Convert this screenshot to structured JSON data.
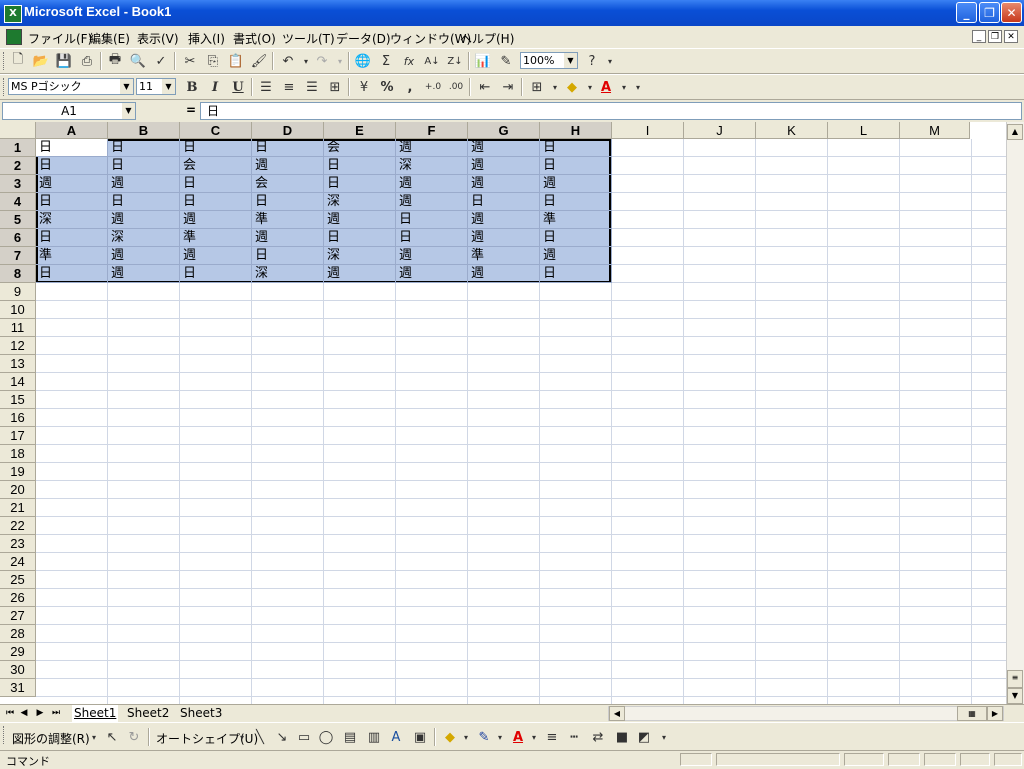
{
  "window": {
    "title": "Microsoft Excel - Book1",
    "app_icon": "X"
  },
  "menu": [
    "ファイル(F)",
    "編集(E)",
    "表示(V)",
    "挿入(I)",
    "書式(O)",
    "ツール(T)",
    "データ(D)",
    "ウィンドウ(W)",
    "ヘルプ(H)"
  ],
  "standard_toolbar": {
    "zoom": "100%"
  },
  "format_toolbar": {
    "font": "MS Pゴシック",
    "size": "11",
    "bold": "B",
    "italic": "I",
    "underline": "U",
    "percent": "%",
    "comma": ","
  },
  "formula_bar": {
    "name_box": "A1",
    "equals": "=",
    "content": "日"
  },
  "columns": [
    "A",
    "B",
    "C",
    "D",
    "E",
    "F",
    "G",
    "H",
    "I",
    "J",
    "K",
    "L",
    "M"
  ],
  "rows": [
    "1",
    "2",
    "3",
    "4",
    "5",
    "6",
    "7",
    "8",
    "9",
    "10",
    "11",
    "12",
    "13",
    "14",
    "15",
    "16",
    "17",
    "18",
    "19",
    "20",
    "21",
    "22",
    "23",
    "24",
    "25",
    "26",
    "27",
    "28",
    "29",
    "30",
    "31"
  ],
  "cells": [
    [
      "日",
      "日",
      "日",
      "日",
      "会",
      "週",
      "週",
      "日"
    ],
    [
      "日",
      "日",
      "会",
      "週",
      "日",
      "深",
      "週",
      "日"
    ],
    [
      "週",
      "週",
      "日",
      "会",
      "日",
      "週",
      "週",
      "週"
    ],
    [
      "日",
      "日",
      "日",
      "日",
      "深",
      "週",
      "日",
      "日"
    ],
    [
      "深",
      "週",
      "週",
      "準",
      "週",
      "日",
      "週",
      "準"
    ],
    [
      "日",
      "深",
      "準",
      "週",
      "日",
      "日",
      "週",
      "日"
    ],
    [
      "準",
      "週",
      "週",
      "日",
      "深",
      "週",
      "準",
      "週"
    ],
    [
      "日",
      "週",
      "日",
      "深",
      "週",
      "週",
      "週",
      "日"
    ]
  ],
  "sheets": [
    "Sheet1",
    "Sheet2",
    "Sheet3"
  ],
  "drawing_toolbar": {
    "draw_menu": "図形の調整(R)",
    "autoshapes": "オートシェイプ(U)"
  },
  "status": {
    "text": "コマンド"
  },
  "colors": {
    "title_bar": "#0a4fd6",
    "selection": "#b6c8e6",
    "chrome": "#ece9d8"
  }
}
